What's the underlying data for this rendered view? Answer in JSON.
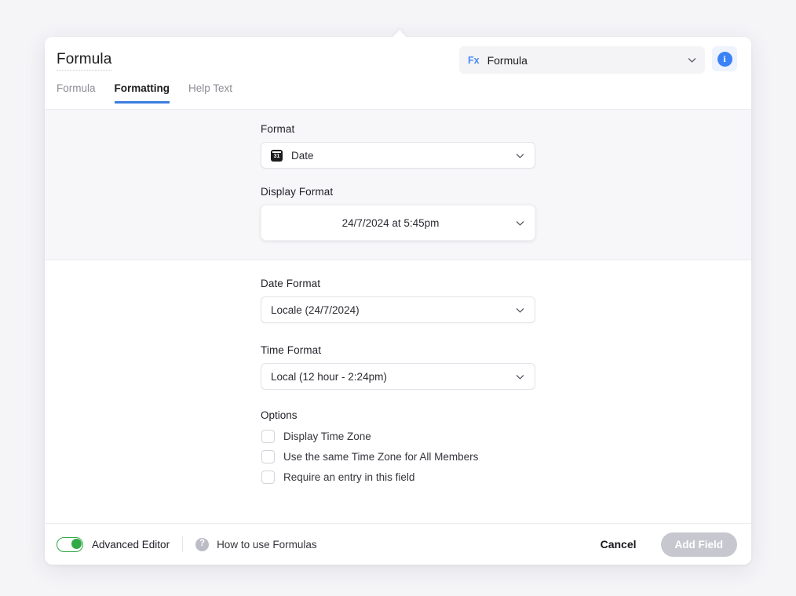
{
  "window": {
    "background": "#f5f5f8"
  },
  "header": {
    "title": "Formula",
    "tabs": [
      {
        "label": "Formula",
        "active": false
      },
      {
        "label": "Formatting",
        "active": true
      },
      {
        "label": "Help Text",
        "active": false
      }
    ],
    "type_select": {
      "icon_label": "Fx",
      "value": "Formula",
      "chevron": "chevron-down-icon"
    },
    "info_button": {
      "glyph": "i",
      "color": "#3b82f6"
    }
  },
  "main": {
    "format": {
      "label": "Format",
      "value": "Date",
      "icon": "calendar-31-icon",
      "icon_day": "31"
    },
    "display_format": {
      "label": "Display Format",
      "value": "24/7/2024 at 5:45pm"
    },
    "date_format": {
      "label": "Date Format",
      "value": "Locale (24/7/2024)"
    },
    "time_format": {
      "label": "Time Format",
      "value": "Local (12 hour - 2:24pm)"
    },
    "options": {
      "label": "Options",
      "items": [
        {
          "label": "Display Time Zone",
          "checked": false
        },
        {
          "label": "Use the same Time Zone for All Members",
          "checked": false
        },
        {
          "label": "Require an entry in this field",
          "checked": false
        }
      ]
    }
  },
  "footer": {
    "advanced_editor": {
      "label": "Advanced Editor",
      "on": true,
      "color": "#2faa46"
    },
    "help": {
      "icon": "question-mark-icon",
      "label": "How to use Formulas"
    },
    "cancel_label": "Cancel",
    "add_label": "Add Field",
    "add_disabled": true
  }
}
